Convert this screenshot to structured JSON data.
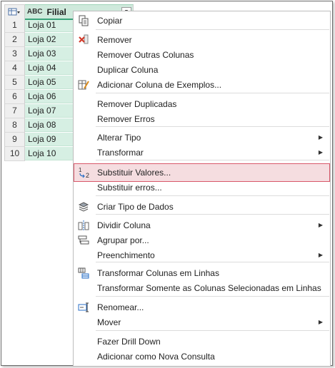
{
  "grid": {
    "column_type_icon": "ABC",
    "column_name": "Filial",
    "rows": [
      {
        "n": "1",
        "v": "Loja 01"
      },
      {
        "n": "2",
        "v": "Loja 02"
      },
      {
        "n": "3",
        "v": "Loja 03"
      },
      {
        "n": "4",
        "v": "Loja 04"
      },
      {
        "n": "5",
        "v": "Loja 05"
      },
      {
        "n": "6",
        "v": "Loja 06"
      },
      {
        "n": "7",
        "v": "Loja 07"
      },
      {
        "n": "8",
        "v": "Loja 08"
      },
      {
        "n": "9",
        "v": "Loja 09"
      },
      {
        "n": "10",
        "v": "Loja 10"
      }
    ]
  },
  "menu": {
    "items": [
      {
        "label": "Copiar",
        "icon": "copy-icon"
      },
      {
        "label": "Remover",
        "icon": "remove-icon"
      },
      {
        "label": "Remover Outras Colunas"
      },
      {
        "label": "Duplicar Coluna"
      },
      {
        "label": "Adicionar Coluna de Exemplos...",
        "icon": "column-examples-icon"
      },
      {
        "label": "Remover Duplicadas"
      },
      {
        "label": "Remover Erros"
      },
      {
        "label": "Alterar Tipo",
        "submenu": true
      },
      {
        "label": "Transformar",
        "submenu": true
      },
      {
        "label": "Substituir Valores...",
        "icon": "replace-values-icon",
        "highlighted": true
      },
      {
        "label": "Substituir erros..."
      },
      {
        "label": "Criar Tipo de Dados",
        "icon": "data-type-icon"
      },
      {
        "label": "Dividir Coluna",
        "icon": "split-column-icon",
        "submenu": true
      },
      {
        "label": "Agrupar por...",
        "icon": "group-by-icon"
      },
      {
        "label": "Preenchimento",
        "submenu": true
      },
      {
        "label": "Transformar Colunas em Linhas",
        "icon": "unpivot-icon"
      },
      {
        "label": "Transformar Somente as Colunas Selecionadas em Linhas"
      },
      {
        "label": "Renomear...",
        "icon": "rename-icon"
      },
      {
        "label": "Mover",
        "submenu": true
      },
      {
        "label": "Fazer Drill Down"
      },
      {
        "label": "Adicionar como Nova Consulta"
      }
    ]
  },
  "colors": {
    "selected_column": "#d6efe3",
    "highlight_border": "#d9586a",
    "highlight_fill": "#f5dde0"
  }
}
